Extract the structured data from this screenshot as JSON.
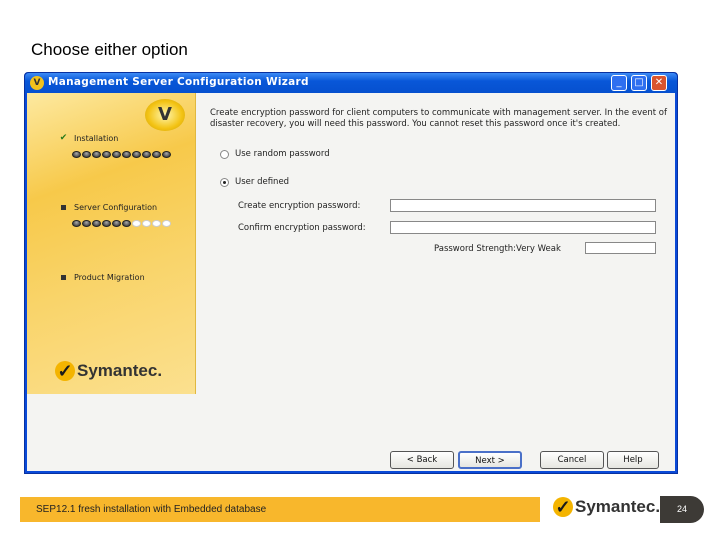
{
  "slide": {
    "title": "Choose either option",
    "footer": "SEP12.1 fresh installation with Embedded database",
    "page": "24",
    "logo": "Symantec."
  },
  "window": {
    "title": "Management Server Configuration Wizard",
    "minimize": "_",
    "maximize": "□",
    "close": "✕"
  },
  "sidebar": {
    "steps": [
      {
        "label": "Installation",
        "done": true,
        "progress": [
          10,
          10
        ]
      },
      {
        "label": "Server Configuration",
        "done": false,
        "progress": [
          6,
          10
        ]
      },
      {
        "label": "Product Migration",
        "done": false
      }
    ],
    "logo": "Symantec."
  },
  "content": {
    "description": "Create encryption password for client computers to communicate with management server. In the event of disaster recovery, you will need this password. You cannot reset this password once it's created.",
    "radio_random": "Use random password",
    "radio_user": "User defined",
    "selected": "User defined",
    "create_label": "Create encryption password:",
    "create_value": "",
    "confirm_label": "Confirm encryption password:",
    "confirm_value": "",
    "strength_label": "Password Strength:Very Weak",
    "strength_value": ""
  },
  "buttons": {
    "back": "< Back",
    "next": "Next >",
    "cancel": "Cancel",
    "help": "Help"
  }
}
